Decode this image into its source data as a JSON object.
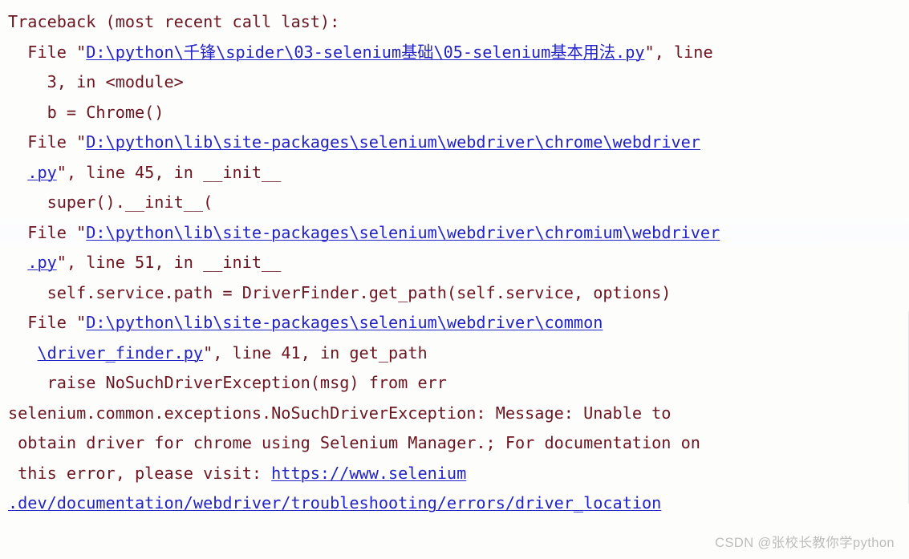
{
  "console": {
    "background_color": "#fdfdfc",
    "text_color": "#6b1521",
    "link_color": "#2222c8",
    "lines": [
      {
        "id": "line-0",
        "text": "Traceback (most recent call last):"
      },
      {
        "id": "line-1",
        "text": "  File \"D:\\python\\千锋\\spider\\03-selenium基础\\05-selenium基本用法.py\", line"
      },
      {
        "id": "line-2",
        "text": "    3, in <module>"
      },
      {
        "id": "line-3",
        "text": "    b = Chrome()"
      },
      {
        "id": "line-4",
        "text": "  File \"D:\\python\\lib\\site-packages\\selenium\\webdriver\\chrome\\webdriver"
      },
      {
        "id": "line-5",
        "text": "  .py\", line 45, in __init__"
      },
      {
        "id": "line-6",
        "text": "    super().__init__("
      },
      {
        "id": "line-7",
        "text": "  File \"D:\\python\\lib\\site-packages\\selenium\\webdriver\\chromium\\webdriver"
      },
      {
        "id": "line-8",
        "text": "  .py\", line 51, in __init__"
      },
      {
        "id": "line-9",
        "text": "    self.service.path = DriverFinder.get_path(self.service, options)"
      },
      {
        "id": "line-10",
        "text": "  File \"D:\\python\\lib\\site-packages\\selenium\\webdriver\\common"
      },
      {
        "id": "line-11",
        "text": "   \\driver_finder.py\", line 41, in get_path"
      },
      {
        "id": "line-12",
        "text": "    raise NoSuchDriverException(msg) from err"
      },
      {
        "id": "line-13",
        "text": "selenium.common.exceptions.NoSuchDriverException: Message: Unable to"
      },
      {
        "id": "line-14",
        "text": " obtain driver for chrome using Selenium Manager.; For documentation on"
      },
      {
        "id": "line-15",
        "text": " this error, please visit: https://www.selenium"
      },
      {
        "id": "line-16",
        "text": ".dev/documentation/webdriver/troubleshooting/errors/driver_location"
      }
    ],
    "segments": [
      [
        {
          "t": "Traceback (most recent call last):",
          "link": false
        }
      ],
      [
        {
          "t": "  File \"",
          "link": false
        },
        {
          "t": "D:\\python\\千锋\\spider\\03-selenium基础\\05-selenium基本用法.py",
          "link": true
        },
        {
          "t": "\", line",
          "link": false
        }
      ],
      [
        {
          "t": "    3, in <module>",
          "link": false
        }
      ],
      [
        {
          "t": "    b = Chrome()",
          "link": false
        }
      ],
      [
        {
          "t": "  File \"",
          "link": false
        },
        {
          "t": "D:\\python\\lib\\site-packages\\selenium\\webdriver\\chrome\\webdriver",
          "link": true
        }
      ],
      [
        {
          "t": "  ",
          "link": false
        },
        {
          "t": ".py",
          "link": true
        },
        {
          "t": "\", line 45, in __init__",
          "link": false
        }
      ],
      [
        {
          "t": "    super().__init__(",
          "link": false
        }
      ],
      [
        {
          "t": "  File \"",
          "link": false
        },
        {
          "t": "D:\\python\\lib\\site-packages\\selenium\\webdriver\\chromium\\webdriver",
          "link": true
        }
      ],
      [
        {
          "t": "  ",
          "link": false
        },
        {
          "t": ".py",
          "link": true
        },
        {
          "t": "\", line 51, in __init__",
          "link": false
        }
      ],
      [
        {
          "t": "    self.service.path = DriverFinder.get_path(self.service, options)",
          "link": false
        }
      ],
      [
        {
          "t": "  File \"",
          "link": false
        },
        {
          "t": "D:\\python\\lib\\site-packages\\selenium\\webdriver\\common",
          "link": true
        }
      ],
      [
        {
          "t": "   ",
          "link": false
        },
        {
          "t": "\\driver_finder.py",
          "link": true
        },
        {
          "t": "\", line 41, in get_path",
          "link": false
        }
      ],
      [
        {
          "t": "    raise NoSuchDriverException(msg) from err",
          "link": false
        }
      ],
      [
        {
          "t": "selenium.common.exceptions.NoSuchDriverException: Message: Unable to",
          "link": false
        }
      ],
      [
        {
          "t": " obtain driver for chrome using Selenium Manager.; For documentation on",
          "link": false
        }
      ],
      [
        {
          "t": " this error, please visit: ",
          "link": false
        },
        {
          "t": "https://www.selenium",
          "link": true
        }
      ],
      [
        {
          "t": ".dev/documentation/webdriver/troubleshooting/errors/driver_location",
          "link": true
        }
      ]
    ],
    "highlight_band_line_index": 7
  },
  "exception": {
    "type": "selenium.common.exceptions.NoSuchDriverException",
    "message": "Unable to obtain driver for chrome using Selenium Manager.; For documentation on this error, please visit: https://www.selenium.dev/documentation/webdriver/troubleshooting/errors/driver_location",
    "documentation_url": "https://www.selenium.dev/documentation/webdriver/troubleshooting/errors/driver_location"
  },
  "watermark": {
    "text": "CSDN @张校长教你学python",
    "color": "#bdbdbd"
  }
}
